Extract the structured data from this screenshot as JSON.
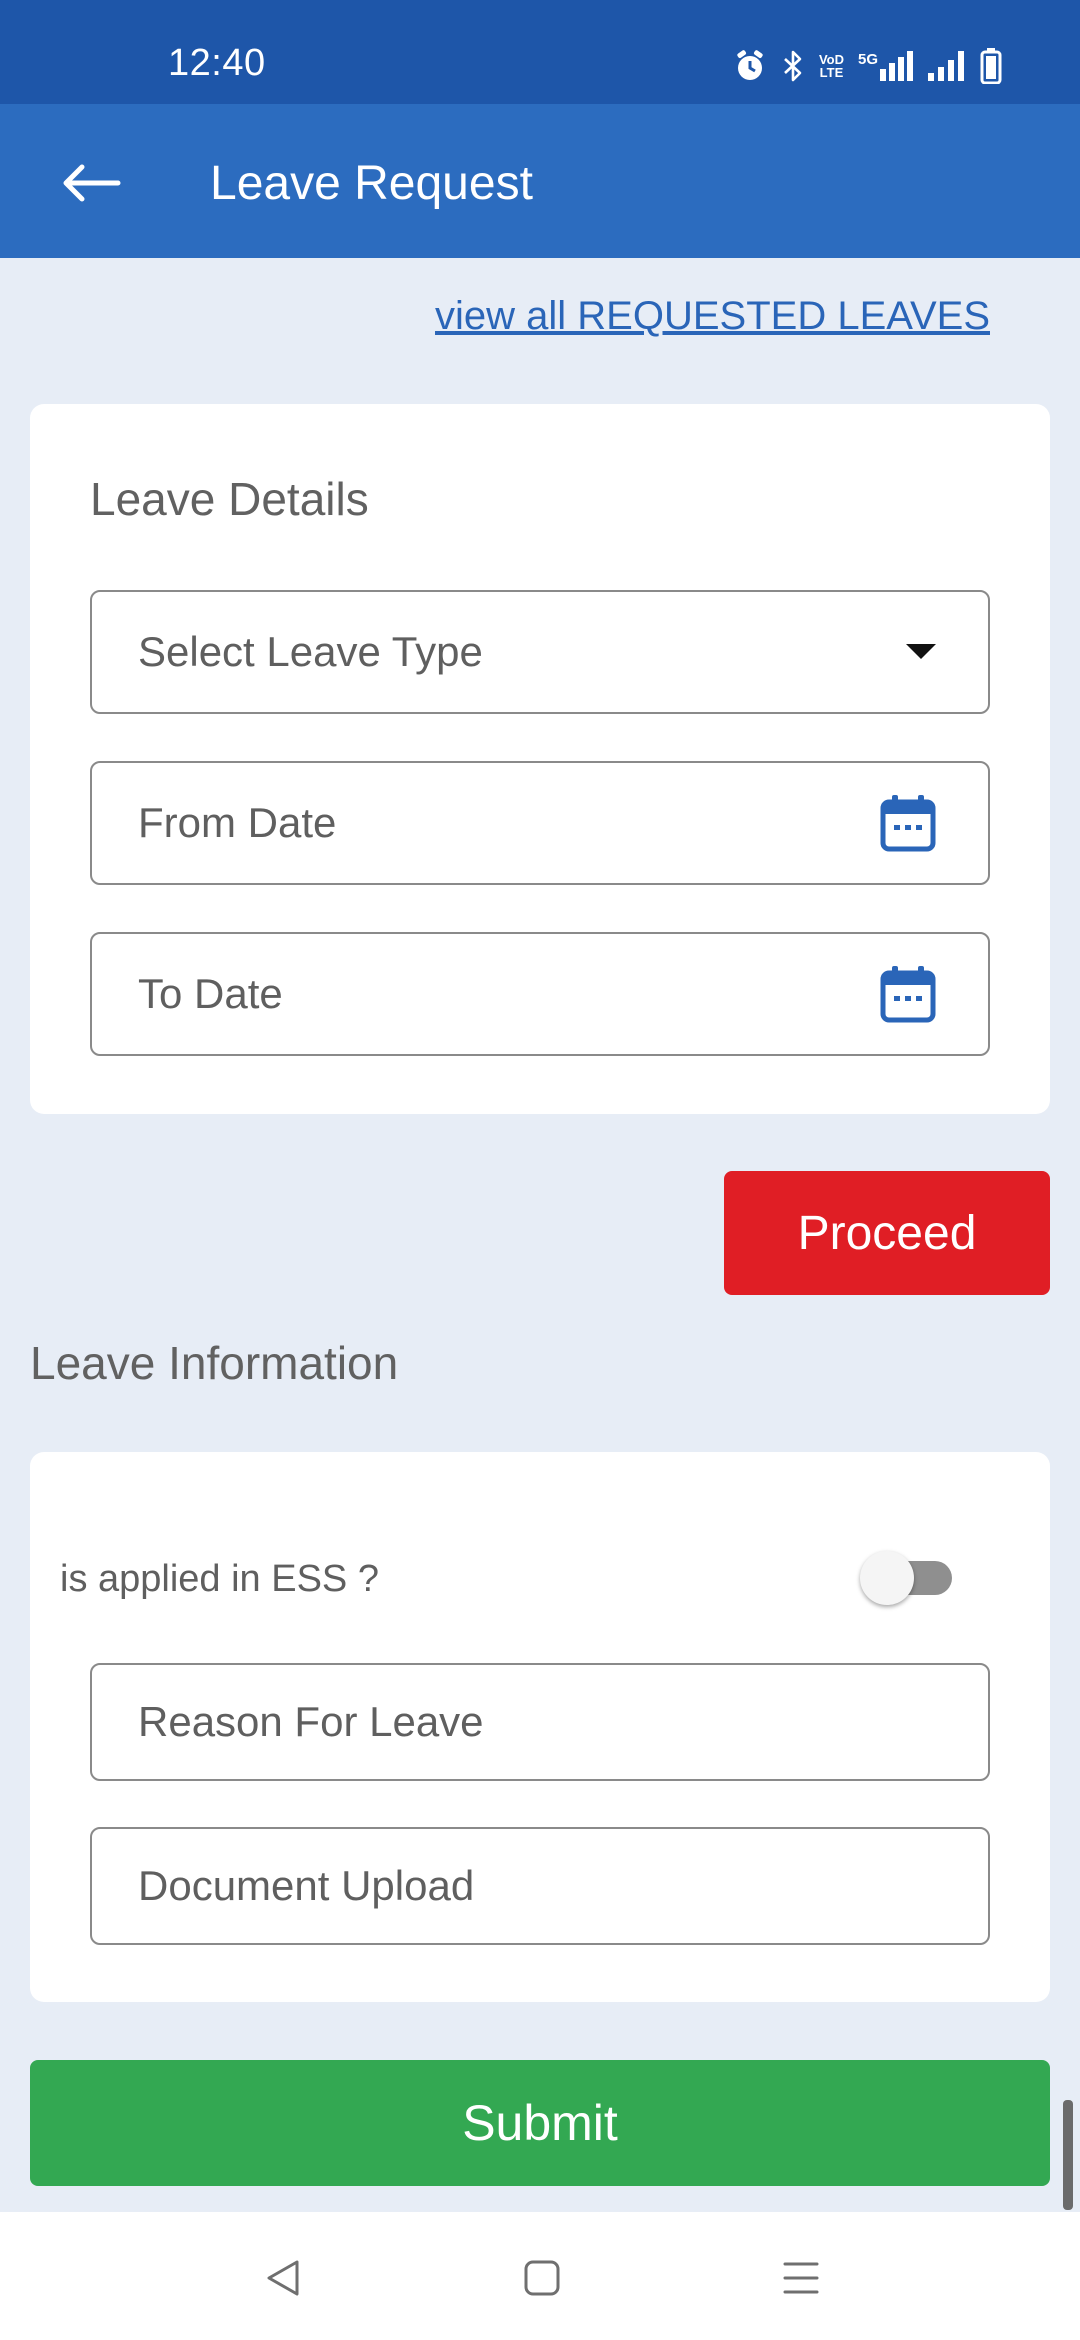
{
  "status_bar": {
    "time": "12:40",
    "volte_line1": "VoD",
    "volte_line2": "LTE",
    "network_type": "5G",
    "icons": [
      "alarm-icon",
      "bluetooth-icon",
      "volte-icon",
      "signal-5g-icon",
      "signal-icon",
      "battery-icon"
    ]
  },
  "app_bar": {
    "back_icon": "arrow-left-icon",
    "title": "Leave Request"
  },
  "view_link": "view all REQUESTED LEAVES",
  "leave_details": {
    "title": "Leave Details",
    "leave_type_placeholder": "Select Leave Type",
    "from_date_placeholder": "From Date",
    "to_date_placeholder": "To Date"
  },
  "proceed_label": "Proceed",
  "leave_information": {
    "title": "Leave Information",
    "toggle_label": "is applied in ESS ?",
    "toggle_on": false,
    "reason_placeholder": "Reason For Leave",
    "document_placeholder": "Document Upload"
  },
  "submit_label": "Submit",
  "nav": {
    "icons": [
      "back-triangle-icon",
      "home-square-icon",
      "recents-menu-icon"
    ]
  },
  "colors": {
    "status_bar": "#1e56a9",
    "app_bar": "#2c6cbf",
    "background": "#e7edf6",
    "link": "#2a65b8",
    "proceed": "#e01e25",
    "submit": "#33a852",
    "calendar_icon": "#2a65b8"
  }
}
